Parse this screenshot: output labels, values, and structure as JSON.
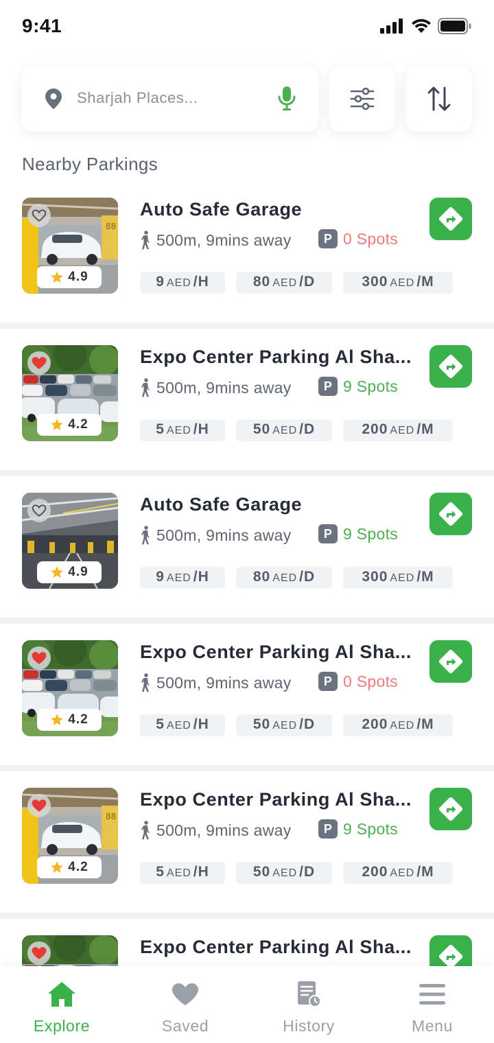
{
  "status_bar": {
    "time": "9:41"
  },
  "search": {
    "placeholder": "Sharjah Places..."
  },
  "section_title": "Nearby Parkings",
  "parkings": [
    {
      "name": "Auto Safe Garage",
      "distance": "500m, 9mins away",
      "spots": "0 Spots",
      "spots_status": "full",
      "rating": "4.9",
      "favorite": false,
      "image": "garage-yellow-pillars",
      "price_hour": "9",
      "price_day": "80",
      "price_month": "300"
    },
    {
      "name": "Expo Center Parking Al Sha...",
      "distance": "500m, 9mins away",
      "spots": "9 Spots",
      "spots_status": "available",
      "rating": "4.2",
      "favorite": true,
      "image": "outdoor-lot",
      "price_hour": "5",
      "price_day": "50",
      "price_month": "200"
    },
    {
      "name": "Auto Safe Garage",
      "distance": "500m, 9mins away",
      "spots": "9 Spots",
      "spots_status": "available",
      "rating": "4.9",
      "favorite": false,
      "image": "underground-garage",
      "price_hour": "9",
      "price_day": "80",
      "price_month": "300"
    },
    {
      "name": "Expo Center Parking Al Sha...",
      "distance": "500m, 9mins away",
      "spots": "0 Spots",
      "spots_status": "full",
      "rating": "4.2",
      "favorite": true,
      "image": "outdoor-lot",
      "price_hour": "5",
      "price_day": "50",
      "price_month": "200"
    },
    {
      "name": "Expo Center Parking Al Sha...",
      "distance": "500m, 9mins away",
      "spots": "9 Spots",
      "spots_status": "available",
      "rating": "4.2",
      "favorite": true,
      "image": "garage-yellow-pillars",
      "price_hour": "5",
      "price_day": "50",
      "price_month": "200"
    },
    {
      "name": "Expo Center Parking Al Sha...",
      "distance": "",
      "spots": "",
      "spots_status": "",
      "rating": "",
      "favorite": true,
      "image": "outdoor-lot",
      "price_hour": "",
      "price_day": "",
      "price_month": ""
    }
  ],
  "price_units": {
    "currency": "AED",
    "hour": "/H",
    "day": "/D",
    "month": "/M"
  },
  "nav": [
    {
      "label": "Explore",
      "icon": "home-icon",
      "active": true
    },
    {
      "label": "Saved",
      "icon": "heart-icon",
      "active": false
    },
    {
      "label": "History",
      "icon": "history-icon",
      "active": false
    },
    {
      "label": "Menu",
      "icon": "menu-icon",
      "active": false
    }
  ],
  "colors": {
    "accent": "#3ab14b",
    "spots_full": "#ef7a7a",
    "spots_available": "#4caf50",
    "favorite": "#e53935"
  }
}
